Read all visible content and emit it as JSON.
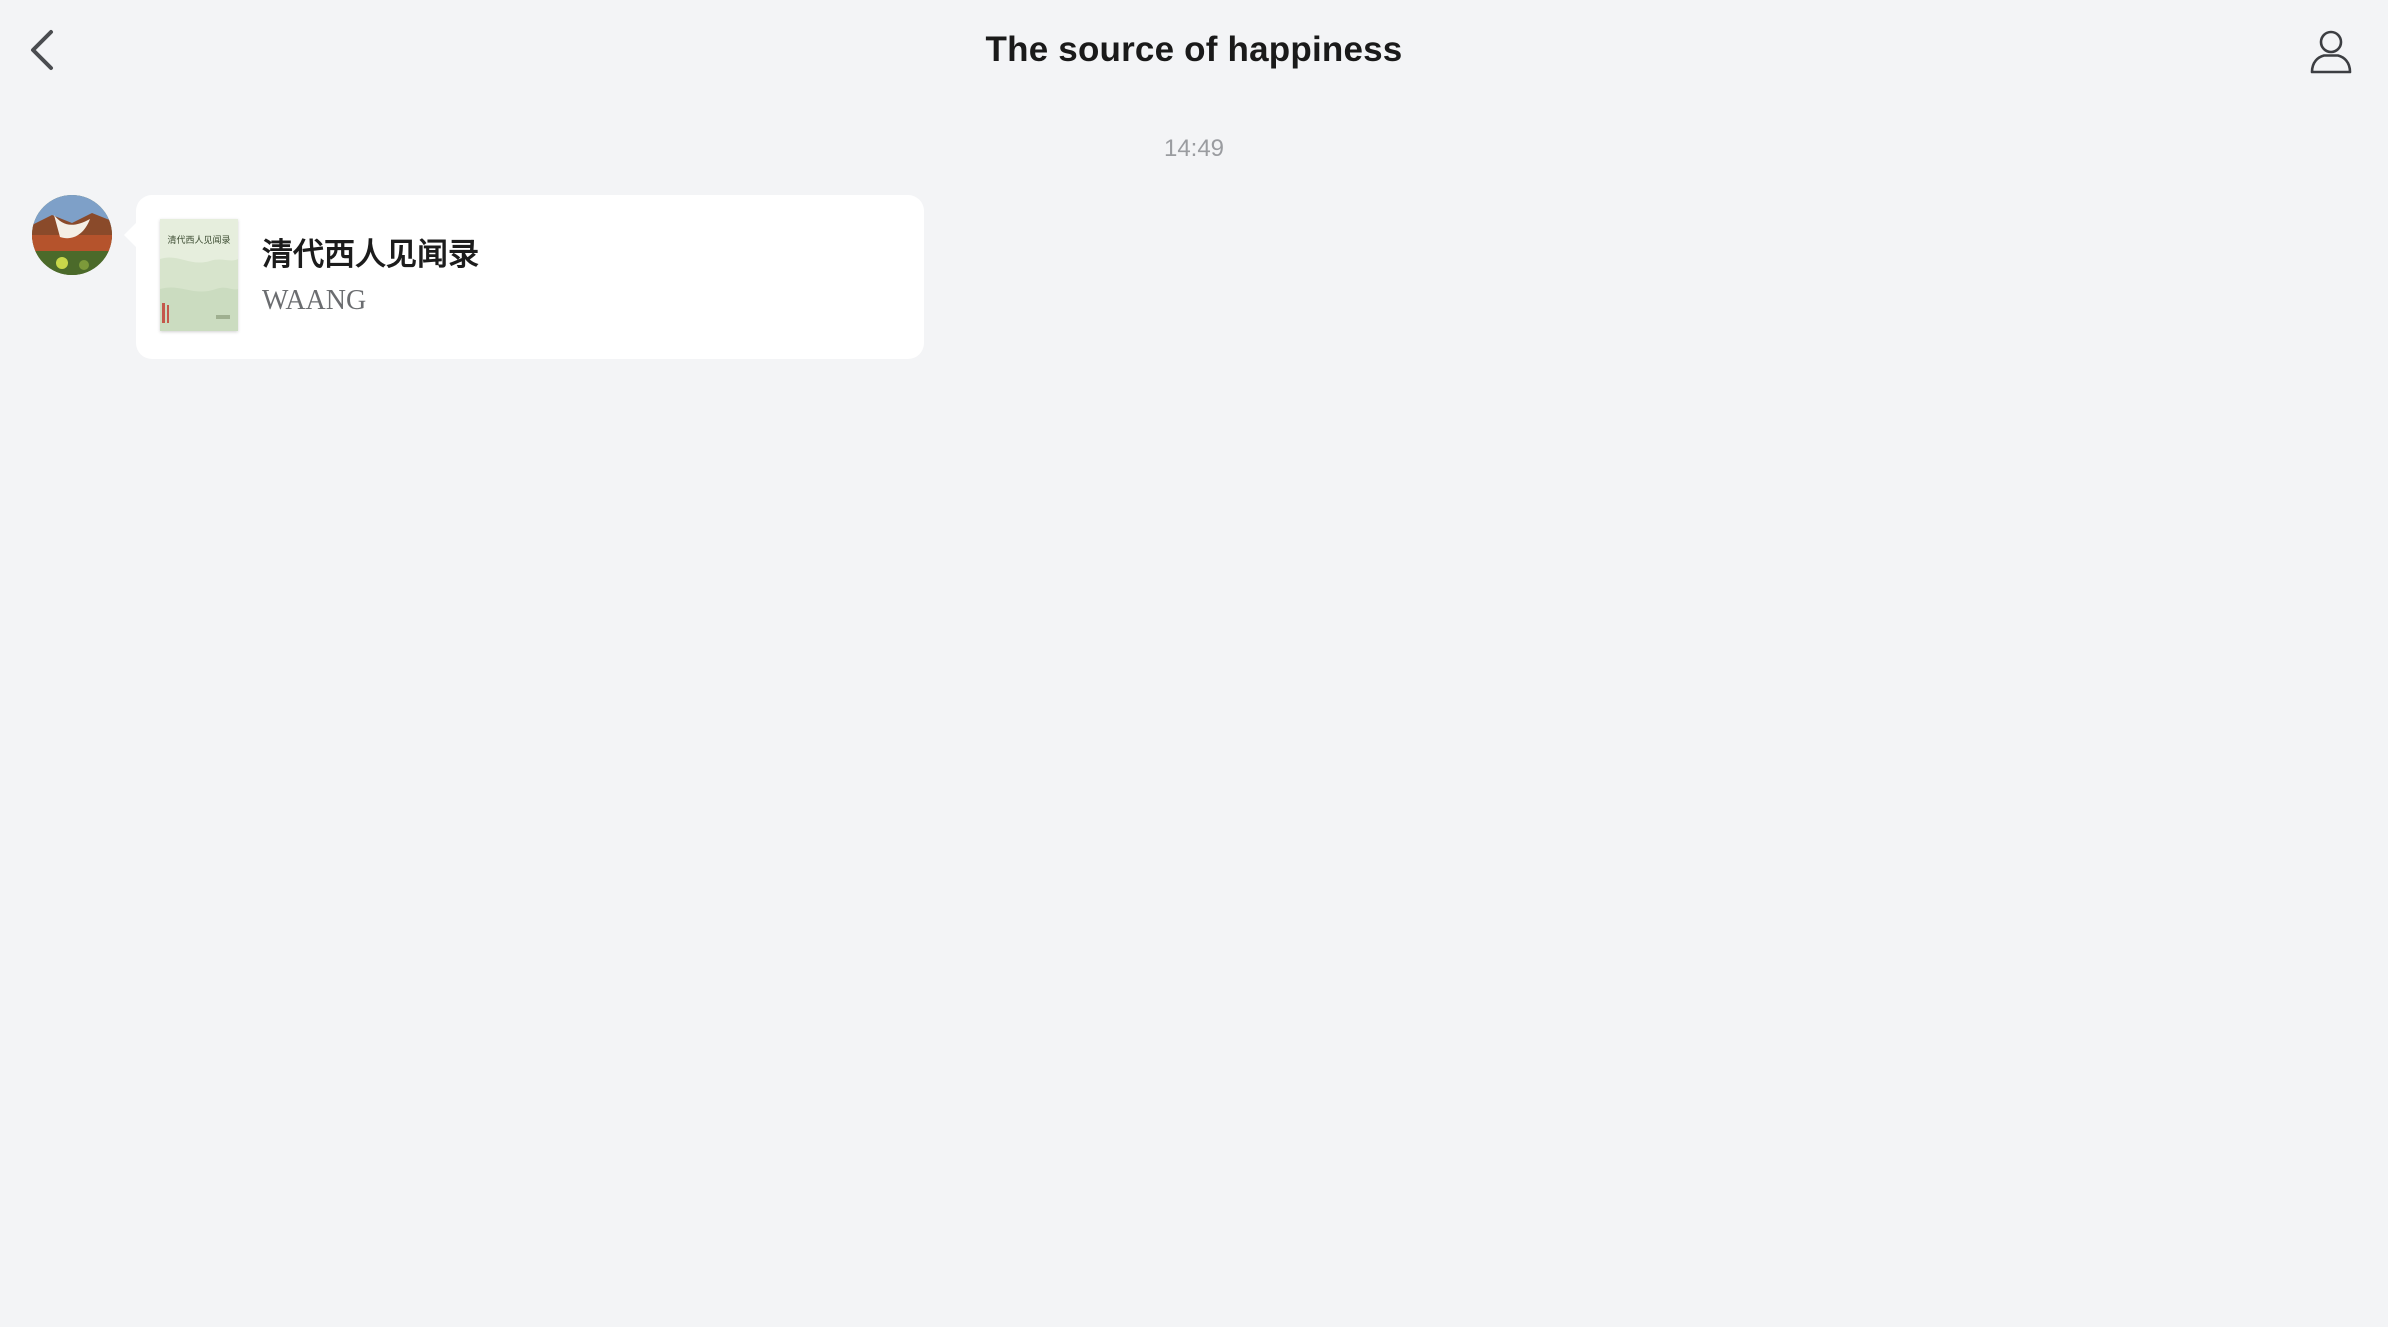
{
  "header": {
    "title": "The source of happiness",
    "back_icon": "chevron-left-icon",
    "profile_icon": "person-outline-icon"
  },
  "chat": {
    "timestamp": "14:49",
    "messages": [
      {
        "type": "book-share",
        "avatar_icon": "avatar-image",
        "book": {
          "title": "清代西人见闻录",
          "author": "WAANG",
          "cover_text": "清代西人见闻录"
        }
      }
    ]
  },
  "colors": {
    "background": "#f3f4f6",
    "bubble": "#ffffff",
    "title_text": "#1a1a1a",
    "muted_text": "#9a9ca0",
    "author_text": "#6b6d70"
  }
}
